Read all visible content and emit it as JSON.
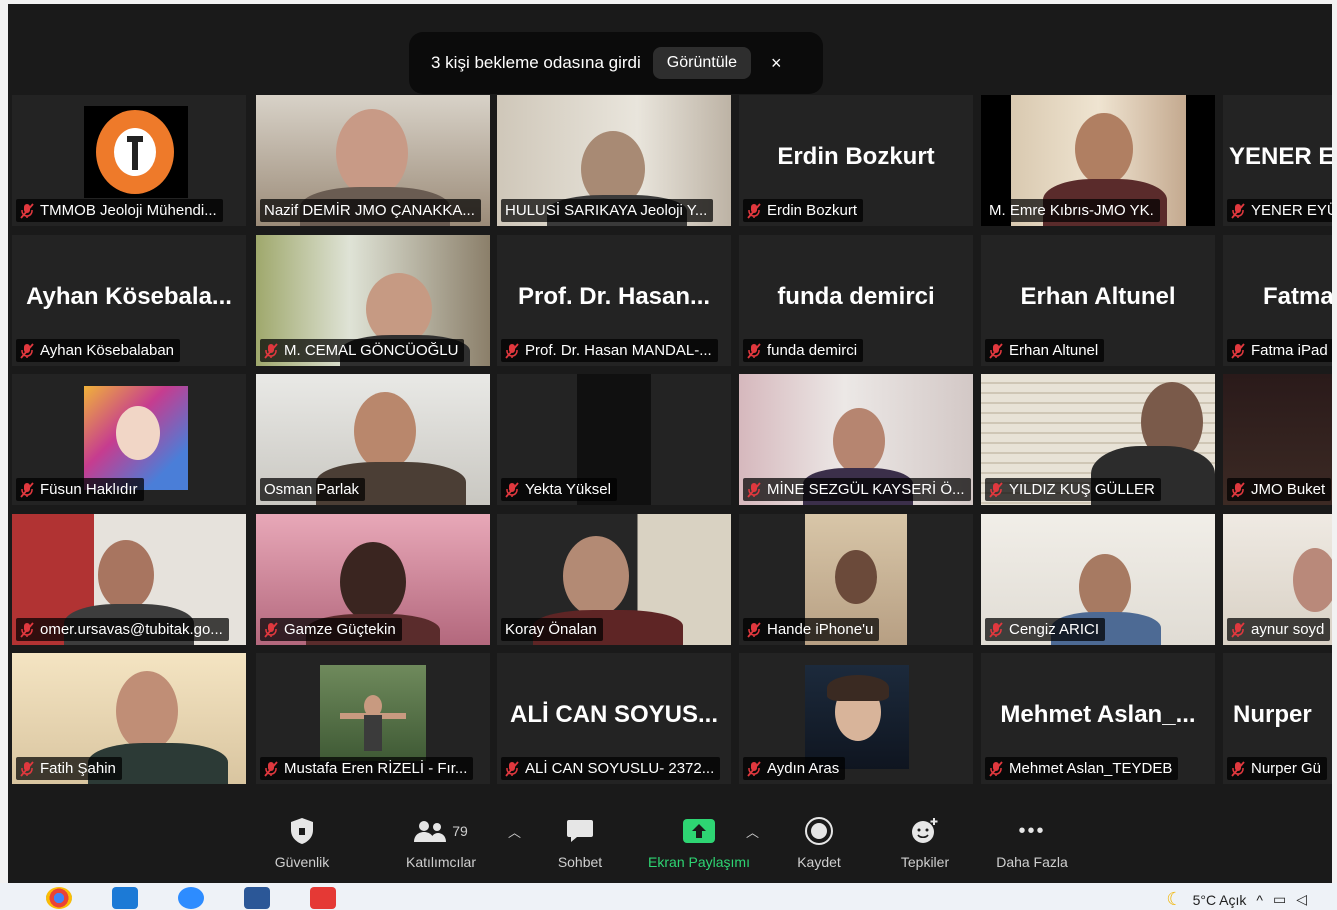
{
  "notification": {
    "message": "3 kişi bekleme odasına girdi",
    "view_button": "Görüntüle",
    "close": "×"
  },
  "tiles": [
    {
      "label": "TMMOB Jeoloji Mühendi...",
      "bigname": "",
      "kind": "logo"
    },
    {
      "label": "Nazif DEMİR JMO ÇANAKKA...",
      "bigname": "",
      "kind": "video"
    },
    {
      "label": "HULUSİ SARIKAYA Jeoloji Y...",
      "bigname": "",
      "kind": "video",
      "active": true
    },
    {
      "label": "Erdin Bozkurt",
      "bigname": "Erdin Bozkurt",
      "kind": "name"
    },
    {
      "label": "M. Emre Kıbrıs-JMO YK.",
      "bigname": "",
      "kind": "video"
    },
    {
      "label": "YENER EYÜ",
      "bigname": "YENER E",
      "kind": "name"
    },
    {
      "label": "Ayhan Kösebalaban",
      "bigname": "Ayhan  Kösebala...",
      "kind": "name"
    },
    {
      "label": "M. CEMAL GÖNCÜOĞLU",
      "bigname": "",
      "kind": "video"
    },
    {
      "label": "Prof. Dr. Hasan MANDAL-...",
      "bigname": "Prof. Dr. Hasan...",
      "kind": "name"
    },
    {
      "label": "funda demirci",
      "bigname": "funda demirci",
      "kind": "name"
    },
    {
      "label": "Erhan Altunel",
      "bigname": "Erhan Altunel",
      "kind": "name"
    },
    {
      "label": "Fatma iPad",
      "bigname": "Fatma",
      "kind": "name"
    },
    {
      "label": "Füsun Haklıdır",
      "bigname": "",
      "kind": "avatar"
    },
    {
      "label": "Osman Parlak",
      "bigname": "",
      "kind": "video"
    },
    {
      "label": "Yekta Yüksel",
      "bigname": "",
      "kind": "dark"
    },
    {
      "label": "MİNE SEZGÜL KAYSERİ Ö...",
      "bigname": "",
      "kind": "video"
    },
    {
      "label": "YILDIZ KUŞ GÜLLER",
      "bigname": "",
      "kind": "video"
    },
    {
      "label": "JMO Buket",
      "bigname": "",
      "kind": "dark"
    },
    {
      "label": "omer.ursavas@tubitak.go...",
      "bigname": "",
      "kind": "video"
    },
    {
      "label": "Gamze Güçtekin",
      "bigname": "",
      "kind": "video"
    },
    {
      "label": "Koray Önalan",
      "bigname": "",
      "kind": "video"
    },
    {
      "label": "Hande iPhone'u",
      "bigname": "",
      "kind": "avatar"
    },
    {
      "label": "Cengiz ARICI",
      "bigname": "",
      "kind": "video"
    },
    {
      "label": "aynur soyd",
      "bigname": "",
      "kind": "video"
    },
    {
      "label": "Fatih Şahin",
      "bigname": "",
      "kind": "video"
    },
    {
      "label": "Mustafa Eren RİZELİ - Fır...",
      "bigname": "",
      "kind": "avatar"
    },
    {
      "label": "ALİ CAN SOYUSLU- 2372...",
      "bigname": "ALİ CAN SOYUS...",
      "kind": "name"
    },
    {
      "label": "Aydın Aras",
      "bigname": "",
      "kind": "avatar"
    },
    {
      "label": "Mehmet Aslan_TEYDEB",
      "bigname": "Mehmet  Aslan_...",
      "kind": "name"
    },
    {
      "label": "Nurper Gü",
      "bigname": "Nurper",
      "kind": "name"
    }
  ],
  "toolbar": {
    "security": "Güvenlik",
    "participants": "Katılımcılar",
    "participant_count": "79",
    "chat": "Sohbet",
    "share": "Ekran Paylaşımı",
    "record": "Kaydet",
    "reactions": "Tepkiler",
    "more": "Daha Fazla",
    "more_icon": "•••"
  },
  "taskbar": {
    "weather": "5°C  Açık"
  },
  "colors": {
    "active_border": "#d7e05f",
    "share_green": "#2ed573",
    "mute_red": "#e0383e"
  }
}
